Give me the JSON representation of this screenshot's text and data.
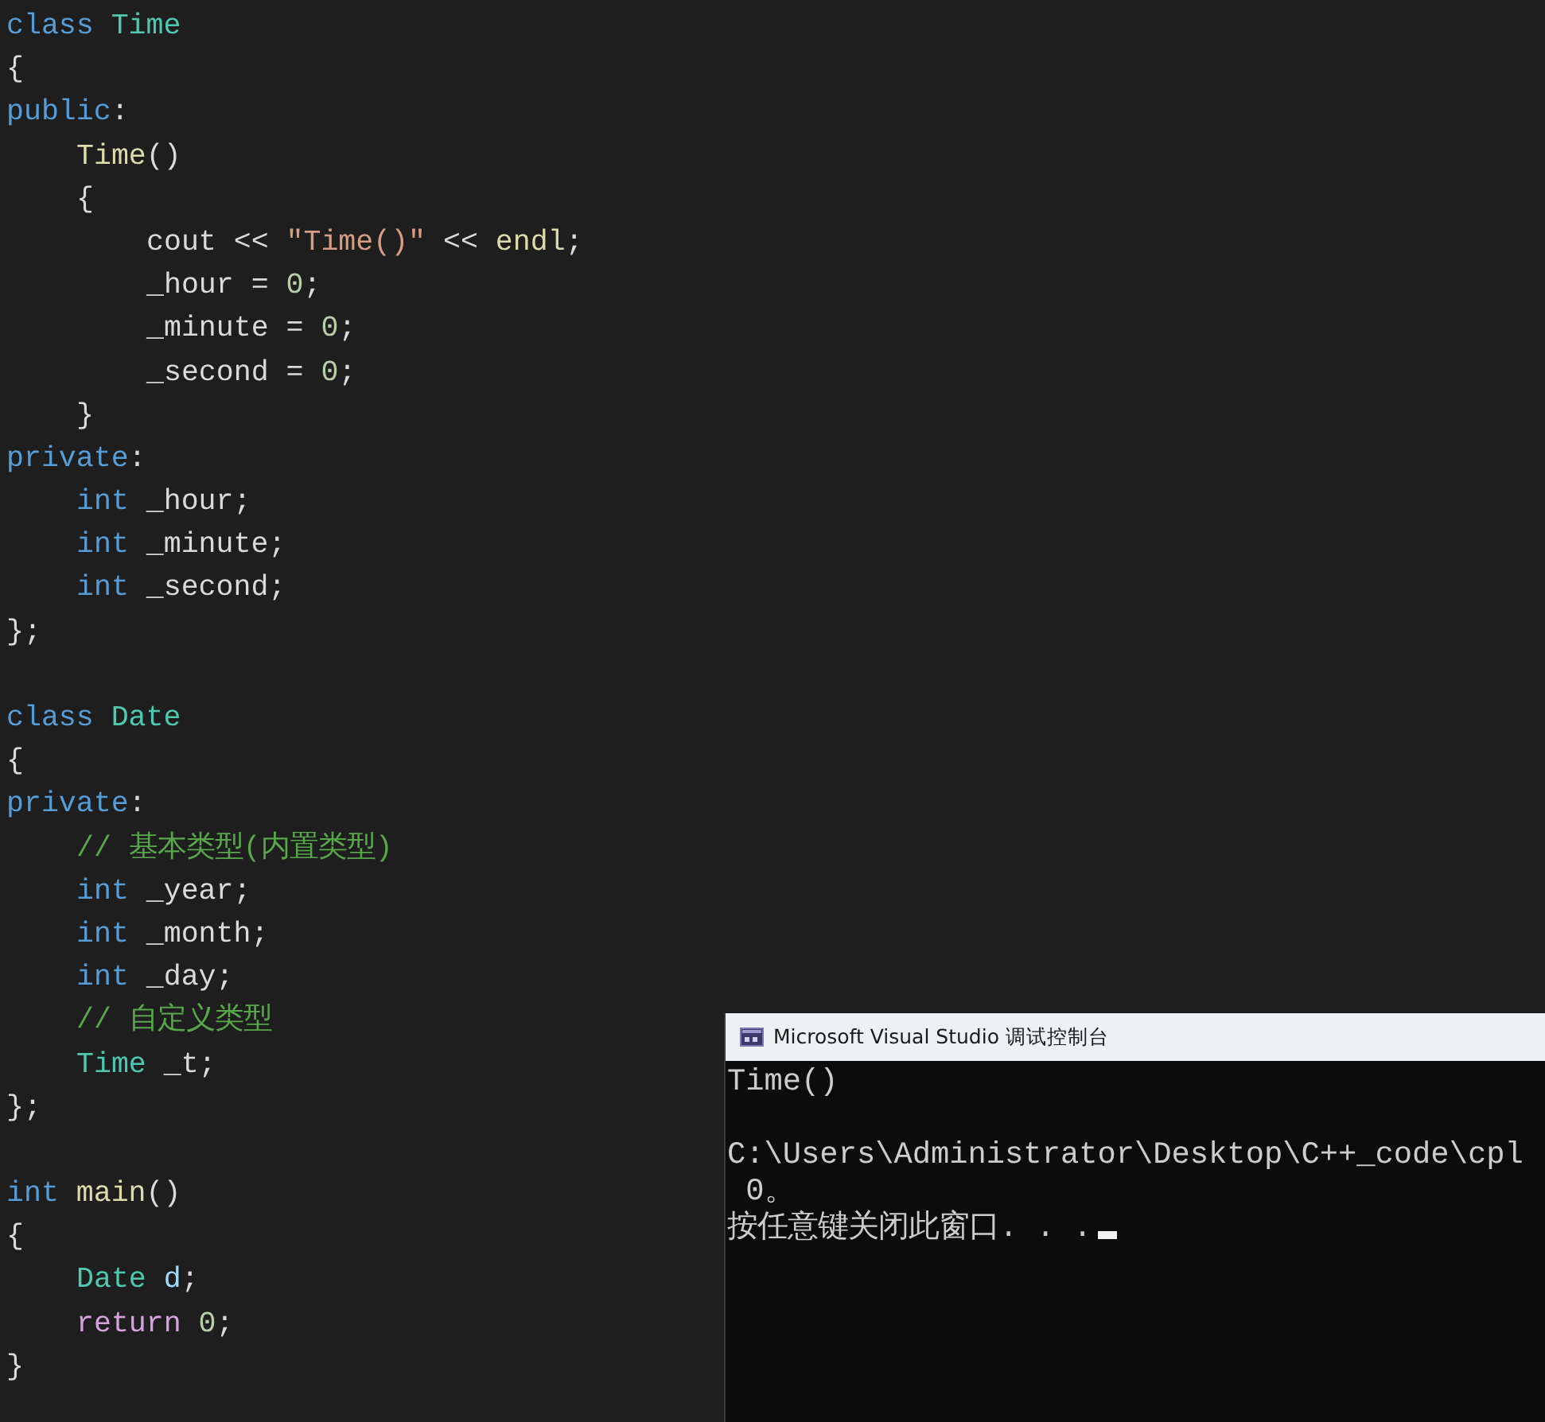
{
  "editor": {
    "lines": [
      {
        "kind": "top",
        "tokens": [
          {
            "kind": "keyword",
            "text": "class "
          },
          {
            "kind": "type",
            "text": "Time"
          }
        ]
      },
      {
        "kind": "top",
        "tokens": [
          {
            "kind": "plain",
            "text": "{"
          }
        ]
      },
      {
        "kind": "top",
        "tokens": [
          {
            "kind": "keyword",
            "text": "public"
          },
          {
            "kind": "plain",
            "text": ":"
          }
        ]
      },
      {
        "kind": "inner",
        "tokens": [
          {
            "kind": "func",
            "text": "Time"
          },
          {
            "kind": "plain",
            "text": "()"
          }
        ]
      },
      {
        "kind": "inner",
        "tokens": [
          {
            "kind": "plain",
            "text": "{"
          }
        ]
      },
      {
        "kind": "deep",
        "tokens": [
          {
            "kind": "plain",
            "text": "cout << "
          },
          {
            "kind": "string",
            "text": "\"Time()\""
          },
          {
            "kind": "plain",
            "text": " << "
          },
          {
            "kind": "func",
            "text": "endl"
          },
          {
            "kind": "plain",
            "text": ";"
          }
        ]
      },
      {
        "kind": "deep",
        "tokens": [
          {
            "kind": "plain",
            "text": "_hour = "
          },
          {
            "kind": "number",
            "text": "0"
          },
          {
            "kind": "plain",
            "text": ";"
          }
        ]
      },
      {
        "kind": "deep",
        "tokens": [
          {
            "kind": "plain",
            "text": "_minute = "
          },
          {
            "kind": "number",
            "text": "0"
          },
          {
            "kind": "plain",
            "text": ";"
          }
        ]
      },
      {
        "kind": "deep",
        "tokens": [
          {
            "kind": "plain",
            "text": "_second = "
          },
          {
            "kind": "number",
            "text": "0"
          },
          {
            "kind": "plain",
            "text": ";"
          }
        ]
      },
      {
        "kind": "inner",
        "tokens": [
          {
            "kind": "plain",
            "text": "}"
          }
        ]
      },
      {
        "kind": "top",
        "tokens": [
          {
            "kind": "keyword",
            "text": "private"
          },
          {
            "kind": "plain",
            "text": ":"
          }
        ]
      },
      {
        "kind": "inner",
        "tokens": [
          {
            "kind": "keyword",
            "text": "int "
          },
          {
            "kind": "plain",
            "text": "_hour;"
          }
        ]
      },
      {
        "kind": "inner",
        "tokens": [
          {
            "kind": "keyword",
            "text": "int "
          },
          {
            "kind": "plain",
            "text": "_minute;"
          }
        ]
      },
      {
        "kind": "inner",
        "tokens": [
          {
            "kind": "keyword",
            "text": "int "
          },
          {
            "kind": "plain",
            "text": "_second;"
          }
        ]
      },
      {
        "kind": "top",
        "tokens": [
          {
            "kind": "plain",
            "text": "};"
          }
        ]
      },
      {
        "kind": "blank"
      },
      {
        "kind": "top",
        "tokens": [
          {
            "kind": "keyword",
            "text": "class "
          },
          {
            "kind": "type",
            "text": "Date"
          }
        ]
      },
      {
        "kind": "top",
        "tokens": [
          {
            "kind": "plain",
            "text": "{"
          }
        ]
      },
      {
        "kind": "top",
        "tokens": [
          {
            "kind": "keyword",
            "text": "private"
          },
          {
            "kind": "plain",
            "text": ":"
          }
        ]
      },
      {
        "kind": "inner",
        "tokens": [
          {
            "kind": "comment",
            "text": "// 基本类型(内置类型)"
          }
        ]
      },
      {
        "kind": "inner",
        "tokens": [
          {
            "kind": "keyword",
            "text": "int "
          },
          {
            "kind": "plain",
            "text": "_year;"
          }
        ]
      },
      {
        "kind": "inner",
        "tokens": [
          {
            "kind": "keyword",
            "text": "int "
          },
          {
            "kind": "plain",
            "text": "_month;"
          }
        ]
      },
      {
        "kind": "inner",
        "tokens": [
          {
            "kind": "keyword",
            "text": "int "
          },
          {
            "kind": "plain",
            "text": "_day;"
          }
        ]
      },
      {
        "kind": "inner",
        "tokens": [
          {
            "kind": "comment",
            "text": "// 自定义类型"
          }
        ]
      },
      {
        "kind": "inner",
        "tokens": [
          {
            "kind": "type",
            "text": "Time "
          },
          {
            "kind": "plain",
            "text": "_t;"
          }
        ]
      },
      {
        "kind": "top",
        "tokens": [
          {
            "kind": "plain",
            "text": "};"
          }
        ]
      },
      {
        "kind": "blank"
      },
      {
        "kind": "top",
        "tokens": [
          {
            "kind": "keyword",
            "text": "int "
          },
          {
            "kind": "func",
            "text": "main"
          },
          {
            "kind": "plain",
            "text": "()"
          }
        ]
      },
      {
        "kind": "top",
        "tokens": [
          {
            "kind": "plain",
            "text": "{"
          }
        ]
      },
      {
        "kind": "inner",
        "tokens": [
          {
            "kind": "type",
            "text": "Date "
          },
          {
            "kind": "variable",
            "text": "d"
          },
          {
            "kind": "plain",
            "text": ";"
          }
        ]
      },
      {
        "kind": "inner",
        "tokens": [
          {
            "kind": "control",
            "text": "return "
          },
          {
            "kind": "number",
            "text": "0"
          },
          {
            "kind": "plain",
            "text": ";"
          }
        ]
      },
      {
        "kind": "top",
        "tokens": [
          {
            "kind": "plain",
            "text": "}"
          }
        ]
      }
    ]
  },
  "console": {
    "title": "Microsoft Visual Studio 调试控制台",
    "lines": [
      {
        "kind": "text",
        "text": "Time()"
      },
      {
        "kind": "blank"
      },
      {
        "kind": "text",
        "text": "C:\\Users\\Administrator\\Desktop\\C++_code\\cpl"
      },
      {
        "kind": "text",
        "text": " 0。"
      },
      {
        "kind": "prompt",
        "text": "按任意键关闭此窗口. . ."
      }
    ]
  }
}
